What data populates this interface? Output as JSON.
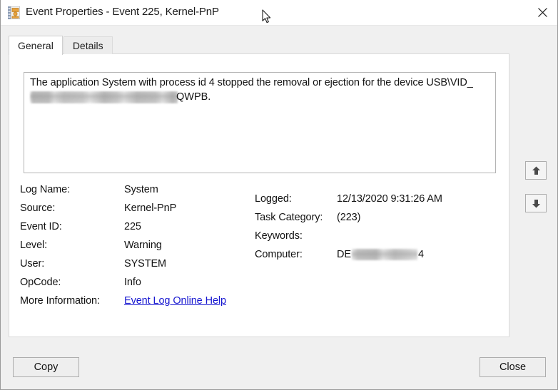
{
  "window": {
    "title": "Event Properties - Event 225, Kernel-PnP",
    "icon": "event-properties-icon",
    "close_label": "×"
  },
  "tabs": [
    {
      "label": "General",
      "active": true
    },
    {
      "label": "Details",
      "active": false
    }
  ],
  "message": {
    "line1": "The application System with process id 4 stopped the removal or ejection for the device USB\\VID_",
    "line2_redacted": true,
    "line2_tail": "QWPB."
  },
  "details": {
    "left": [
      {
        "label": "Log Name:",
        "value": "System"
      },
      {
        "label": "Source:",
        "value": "Kernel-PnP"
      },
      {
        "label": "Event ID:",
        "value": "225"
      },
      {
        "label": "Level:",
        "value": "Warning"
      },
      {
        "label": "User:",
        "value": "SYSTEM"
      },
      {
        "label": "OpCode:",
        "value": "Info"
      }
    ],
    "more_information": {
      "label": "More Information:",
      "link_text": "Event Log Online Help"
    },
    "right": [
      {
        "label": "Logged:",
        "value": "12/13/2020 9:31:26 AM"
      },
      {
        "label": "Task Category:",
        "value": "(223)"
      },
      {
        "label": "Keywords:",
        "value": ""
      },
      {
        "label": "Computer:",
        "value_prefix": "DE",
        "value_suffix": "4",
        "redacted": true
      }
    ]
  },
  "navigation": {
    "previous_label": "up-arrow-icon",
    "next_label": "down-arrow-icon"
  },
  "buttons": {
    "copy": "Copy",
    "close": "Close"
  },
  "colors": {
    "dialog_background": "#f0f0f0",
    "panel_background": "#ffffff",
    "link": "#1717d0",
    "text": "#121212",
    "border": "#adadad"
  }
}
